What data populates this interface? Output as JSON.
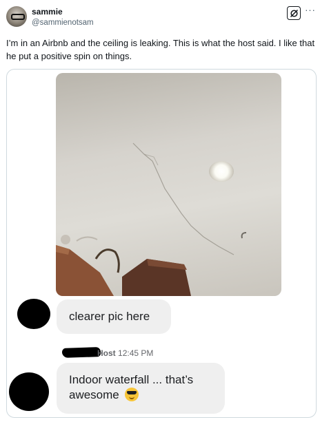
{
  "author": {
    "name": "sammie",
    "handle": "@sammienotsam"
  },
  "header_icons": {
    "grok": "grok-icon",
    "more": "more-icon",
    "more_glyph": "···"
  },
  "tweet": {
    "text": "I’m in an Airbnb and the ceiling is leaking. This is what the host said. I like that he put a positive spin on things."
  },
  "screenshot": {
    "message_1": "clearer pic here",
    "host_label": "Host",
    "host_time": "12:45 PM",
    "message_2": "Indoor waterfall ... that’s awesome",
    "message_2_emoji": "smiling-face-with-sunglasses-icon"
  },
  "colors": {
    "bubble_bg": "#efefef",
    "text_primary": "#0f1419",
    "text_secondary": "#536471"
  }
}
